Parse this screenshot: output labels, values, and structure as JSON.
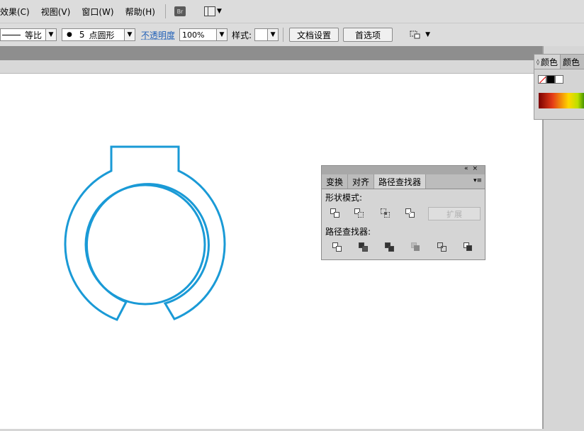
{
  "menu": {
    "effect": "效果(C)",
    "view": "视图(V)",
    "window": "窗口(W)",
    "help": "帮助(H)",
    "bridge": "Br"
  },
  "control": {
    "stroke_profile": "等比",
    "brush_value": "5",
    "brush_label": "点圆形",
    "opacity_label": "不透明度",
    "opacity_value": "100%",
    "style_label": "样式:",
    "doc_setup": "文档设置",
    "preferences": "首选项"
  },
  "color_panel": {
    "tab_color": "颜色",
    "tab_color_guide": "颜色"
  },
  "pathfinder": {
    "tabs": [
      "变换",
      "对齐",
      "路径查找器"
    ],
    "shape_modes_label": "形状模式:",
    "pathfinders_label": "路径查找器:",
    "expand_label": "扩展"
  },
  "colors": {
    "shape_stroke": "#1a9ad6",
    "canvas": "#ffffff",
    "ui_bg": "#dcdcdc"
  }
}
